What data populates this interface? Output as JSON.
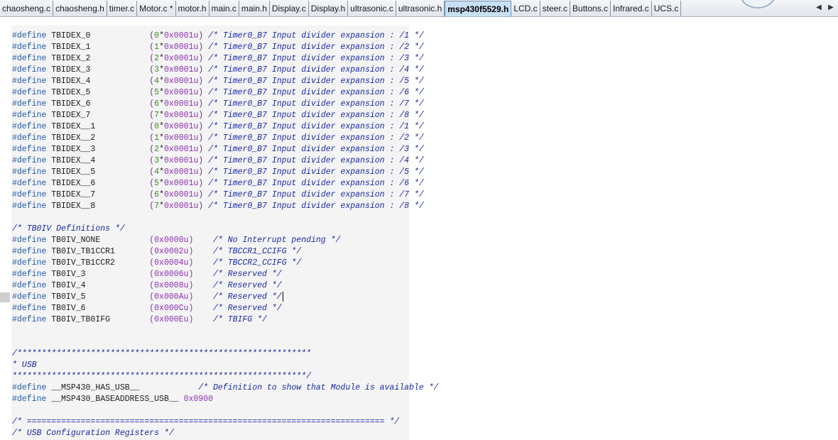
{
  "tabs": [
    {
      "label": "chaosheng.c",
      "active": false
    },
    {
      "label": "chaosheng.h",
      "active": false
    },
    {
      "label": "timer.c",
      "active": false
    },
    {
      "label": "Motor.c *",
      "active": false
    },
    {
      "label": "motor.h",
      "active": false
    },
    {
      "label": "main.c",
      "active": false
    },
    {
      "label": "main.h",
      "active": false
    },
    {
      "label": "Display.c",
      "active": false
    },
    {
      "label": "Display.h",
      "active": false
    },
    {
      "label": "ultrasonic.c",
      "active": false
    },
    {
      "label": "ultrasonic.h",
      "active": false
    },
    {
      "label": "msp430f5529.h",
      "active": true
    },
    {
      "label": "LCD.c",
      "active": false
    },
    {
      "label": "steer.c",
      "active": false
    },
    {
      "label": "Buttons.c",
      "active": false
    },
    {
      "label": "Infrared.c",
      "active": false
    },
    {
      "label": "UCS.c",
      "active": false
    }
  ],
  "tab_scroll": {
    "left": "◀",
    "right": "▶"
  },
  "code": {
    "define_kw": "#define",
    "lines": [
      {
        "row": 0,
        "type": "def",
        "name": "TBIDEX_0",
        "mult": "0",
        "hex": "0x0001u",
        "comment": "/* Timer0_B7 Input divider expansion : /1 */"
      },
      {
        "row": 1,
        "type": "def",
        "name": "TBIDEX_1",
        "mult": "1",
        "hex": "0x0001u",
        "comment": "/* Timer0_B7 Input divider expansion : /2 */"
      },
      {
        "row": 2,
        "type": "def",
        "name": "TBIDEX_2",
        "mult": "2",
        "hex": "0x0001u",
        "comment": "/* Timer0_B7 Input divider expansion : /3 */"
      },
      {
        "row": 3,
        "type": "def",
        "name": "TBIDEX_3",
        "mult": "3",
        "hex": "0x0001u",
        "comment": "/* Timer0_B7 Input divider expansion : /4 */"
      },
      {
        "row": 4,
        "type": "def",
        "name": "TBIDEX_4",
        "mult": "4",
        "hex": "0x0001u",
        "comment": "/* Timer0_B7 Input divider expansion : /5 */"
      },
      {
        "row": 5,
        "type": "def",
        "name": "TBIDEX_5",
        "mult": "5",
        "hex": "0x0001u",
        "comment": "/* Timer0_B7 Input divider expansion : /6 */"
      },
      {
        "row": 6,
        "type": "def",
        "name": "TBIDEX_6",
        "mult": "6",
        "hex": "0x0001u",
        "comment": "/* Timer0_B7 Input divider expansion : /7 */"
      },
      {
        "row": 7,
        "type": "def",
        "name": "TBIDEX_7",
        "mult": "7",
        "hex": "0x0001u",
        "comment": "/* Timer0_B7 Input divider expansion : /8 */"
      },
      {
        "row": 8,
        "type": "def",
        "name": "TBIDEX__1",
        "mult": "0",
        "hex": "0x0001u",
        "comment": "/* Timer0_B7 Input divider expansion : /1 */"
      },
      {
        "row": 9,
        "type": "def",
        "name": "TBIDEX__2",
        "mult": "1",
        "hex": "0x0001u",
        "comment": "/* Timer0_B7 Input divider expansion : /2 */"
      },
      {
        "row": 10,
        "type": "def",
        "name": "TBIDEX__3",
        "mult": "2",
        "hex": "0x0001u",
        "comment": "/* Timer0_B7 Input divider expansion : /3 */"
      },
      {
        "row": 11,
        "type": "def",
        "name": "TBIDEX__4",
        "mult": "3",
        "hex": "0x0001u",
        "comment": "/* Timer0_B7 Input divider expansion : /4 */"
      },
      {
        "row": 12,
        "type": "def",
        "name": "TBIDEX__5",
        "mult": "4",
        "hex": "0x0001u",
        "comment": "/* Timer0_B7 Input divider expansion : /5 */"
      },
      {
        "row": 13,
        "type": "def",
        "name": "TBIDEX__6",
        "mult": "5",
        "hex": "0x0001u",
        "comment": "/* Timer0_B7 Input divider expansion : /6 */"
      },
      {
        "row": 14,
        "type": "def",
        "name": "TBIDEX__7",
        "mult": "6",
        "hex": "0x0001u",
        "comment": "/* Timer0_B7 Input divider expansion : /7 */"
      },
      {
        "row": 15,
        "type": "def",
        "name": "TBIDEX__8",
        "mult": "7",
        "hex": "0x0001u",
        "comment": "/* Timer0_B7 Input divider expansion : /8 */"
      },
      {
        "row": 17,
        "type": "comment",
        "text": "/* TB0IV Definitions */"
      },
      {
        "row": 18,
        "type": "defv",
        "name": "TB0IV_NONE",
        "value": "(0x0000u)",
        "comment": "/* No Interrupt pending */"
      },
      {
        "row": 19,
        "type": "defv",
        "name": "TB0IV_TB1CCR1",
        "value": "(0x0002u)",
        "comment": "/* TBCCR1_CCIFG */"
      },
      {
        "row": 20,
        "type": "defv",
        "name": "TB0IV_TB1CCR2",
        "value": "(0x0004u)",
        "comment": "/* TBCCR2_CCIFG */"
      },
      {
        "row": 21,
        "type": "defv",
        "name": "TB0IV_3",
        "value": "(0x0006u)",
        "comment": "/* Reserved */"
      },
      {
        "row": 22,
        "type": "defv",
        "name": "TB0IV_4",
        "value": "(0x0008u)",
        "comment": "/* Reserved */"
      },
      {
        "row": 23,
        "type": "defv",
        "name": "TB0IV_5",
        "value": "(0x000Au)",
        "comment": "/* Reserved */",
        "cursor": true
      },
      {
        "row": 24,
        "type": "defv",
        "name": "TB0IV_6",
        "value": "(0x000Cu)",
        "comment": "/* Reserved */"
      },
      {
        "row": 25,
        "type": "defv",
        "name": "TB0IV_TB0IFG",
        "value": "(0x000Eu)",
        "comment": "/* TBIFG */"
      },
      {
        "row": 28,
        "type": "comment",
        "text": "/************************************************************"
      },
      {
        "row": 29,
        "type": "comment",
        "text": "* USB"
      },
      {
        "row": 30,
        "type": "comment",
        "text": "************************************************************/"
      },
      {
        "row": 31,
        "type": "defc",
        "name": "__MSP430_HAS_USB__",
        "comment": "/* Definition to show that Module is available */"
      },
      {
        "row": 32,
        "type": "defa",
        "name": "__MSP430_BASEADDRESS_USB__",
        "value": "0x0900"
      },
      {
        "row": 34,
        "type": "comment",
        "text": "/* ========================================================================= */"
      },
      {
        "row": 35,
        "type": "comment",
        "text": "/* USB Configuration Registers */"
      }
    ]
  }
}
